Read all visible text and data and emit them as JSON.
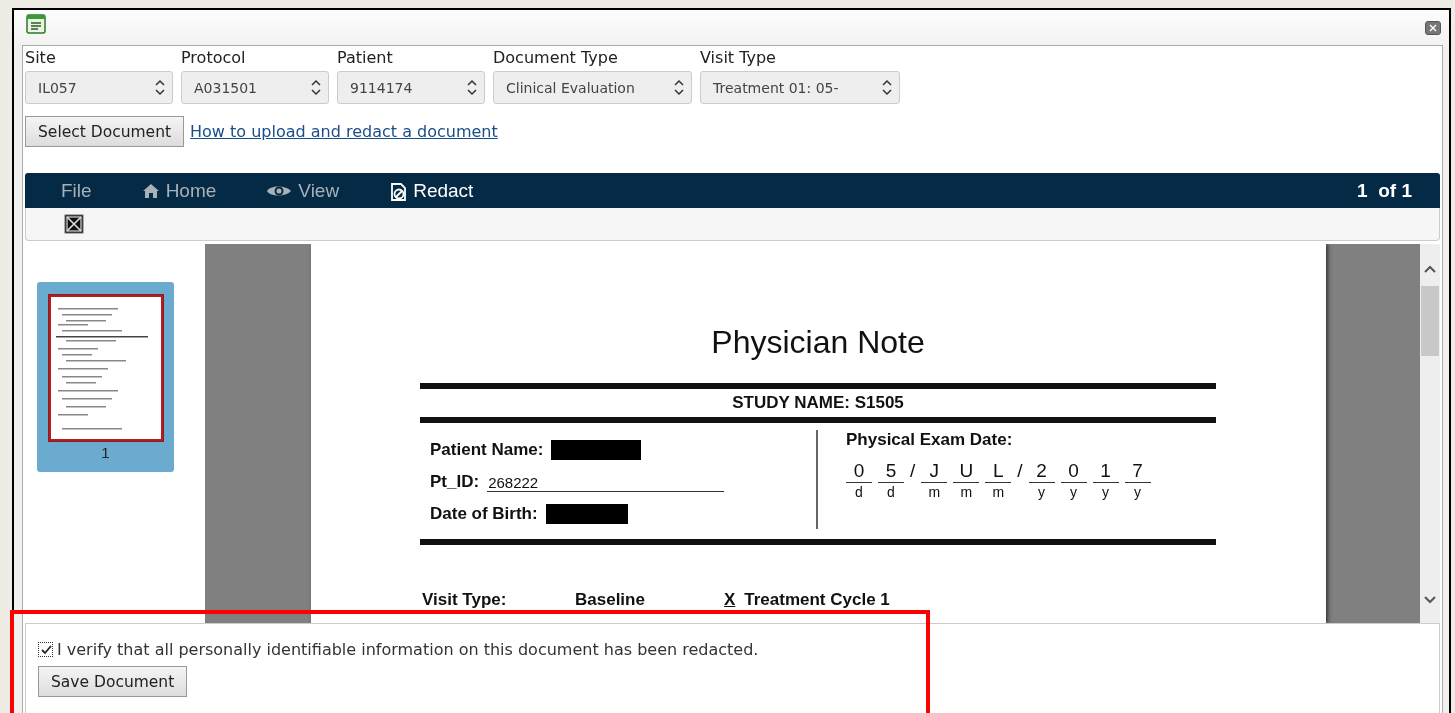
{
  "filters": [
    {
      "label": "Site",
      "value": "IL057"
    },
    {
      "label": "Protocol",
      "value": "A031501"
    },
    {
      "label": "Patient",
      "value": "9114174"
    },
    {
      "label": "Document Type",
      "value": "Clinical Evaluation"
    },
    {
      "label": "Visit Type",
      "value": "Treatment 01: 05-"
    }
  ],
  "select_button": "Select Document",
  "help_link": "How to upload and redact a document",
  "viewer": {
    "menu": [
      {
        "label": "File",
        "kind": "plain",
        "selected": false
      },
      {
        "label": "Home",
        "kind": "home",
        "selected": false
      },
      {
        "label": "View",
        "kind": "view",
        "selected": false
      },
      {
        "label": "Redact",
        "kind": "redact",
        "selected": true
      }
    ],
    "page_counter": "1  of 1",
    "thumbnails": [
      {
        "label": "1",
        "selected": true
      }
    ],
    "document": {
      "title": "Physician Note",
      "study": "STUDY NAME:  S1505",
      "fields": [
        {
          "label": "Patient Name:",
          "redacted": true
        },
        {
          "label": "Pt_ID:",
          "value": "268222",
          "redacted": false
        },
        {
          "label": "Date of Birth:",
          "redacted": true
        }
      ],
      "exam_date_label": "Physical Exam Date:",
      "exam_date": [
        {
          "kind": "cell",
          "value": "0",
          "hint": "d"
        },
        {
          "kind": "cell",
          "value": "5",
          "hint": "d"
        },
        {
          "kind": "sep",
          "value": "/"
        },
        {
          "kind": "cell",
          "value": "J",
          "hint": "m"
        },
        {
          "kind": "cell",
          "value": "U",
          "hint": "m"
        },
        {
          "kind": "cell",
          "value": "L",
          "hint": "m"
        },
        {
          "kind": "sep",
          "value": "/"
        },
        {
          "kind": "cell",
          "value": "2",
          "hint": "y"
        },
        {
          "kind": "cell",
          "value": "0",
          "hint": "y"
        },
        {
          "kind": "cell",
          "value": "1",
          "hint": "y"
        },
        {
          "kind": "cell",
          "value": "7",
          "hint": "y"
        }
      ],
      "visit_type_label": "Visit Type:",
      "visit_options": [
        {
          "label": "Baseline"
        },
        {
          "label": "Treatment Cycle 1",
          "mark": "X"
        }
      ]
    }
  },
  "verify": {
    "label": "I verify that all personally identifiable information on this document has been redacted.",
    "checked": true
  },
  "save_button": "Save Document",
  "highlight": true
}
